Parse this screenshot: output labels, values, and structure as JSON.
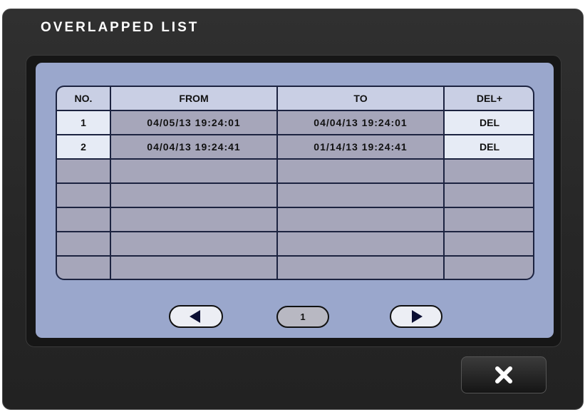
{
  "dialog": {
    "title": "OVERLAPPED LIST"
  },
  "table": {
    "headers": {
      "no": "NO.",
      "from": "FROM",
      "to": "TO",
      "del": "DEL+"
    },
    "rows": [
      {
        "no": "1",
        "from": "04/05/13  19:24:01",
        "to": "04/04/13  19:24:01",
        "del": "DEL"
      },
      {
        "no": "2",
        "from": "04/04/13  19:24:41",
        "to": "01/14/13  19:24:41",
        "del": "DEL"
      }
    ],
    "empty_rows": 5
  },
  "pagination": {
    "prev_icon": "triangle-left-icon",
    "page": "1",
    "next_icon": "triangle-right-icon"
  },
  "close_button": {
    "icon": "x-close-icon"
  },
  "colors": {
    "dialog_bg": "#262626",
    "panel_bg": "#9aa7cc",
    "header_cell": "#c9cfe4",
    "light_cell": "#e6ebf5",
    "gray_cell": "#a6a6ba",
    "grid_line": "#1c2340"
  }
}
